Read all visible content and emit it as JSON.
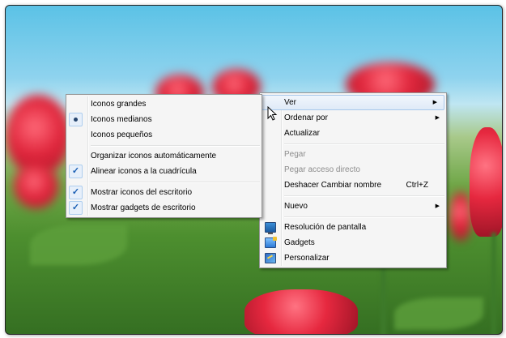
{
  "main_menu": {
    "items": [
      {
        "label": "Ver",
        "arrow": "▶"
      },
      {
        "label": "Ordenar por",
        "arrow": "▶"
      },
      {
        "label": "Actualizar"
      },
      {
        "label": "Pegar"
      },
      {
        "label": "Pegar acceso directo"
      },
      {
        "label": "Deshacer Cambiar nombre",
        "shortcut": "Ctrl+Z"
      },
      {
        "label": "Nuevo",
        "arrow": "▶"
      },
      {
        "label": "Resolución de pantalla",
        "icon": "display-icon"
      },
      {
        "label": "Gadgets",
        "icon": "gadgets-icon"
      },
      {
        "label": "Personalizar",
        "icon": "personalize-icon"
      }
    ]
  },
  "view_submenu": {
    "items": [
      {
        "label": "Iconos grandes"
      },
      {
        "label": "Iconos medianos",
        "selected": true
      },
      {
        "label": "Iconos pequeños"
      },
      {
        "label": "Organizar iconos automáticamente"
      },
      {
        "label": "Alinear iconos a la cuadrícula",
        "checked": true
      },
      {
        "label": "Mostrar iconos del escritorio",
        "checked": true
      },
      {
        "label": "Mostrar gadgets de escritorio",
        "checked": true
      }
    ],
    "check_glyph": "✓"
  },
  "colors": {
    "menu_bg": "#f5f5f5",
    "highlight_border": "#a8c8ec",
    "disabled_text": "#8d8d8d"
  }
}
